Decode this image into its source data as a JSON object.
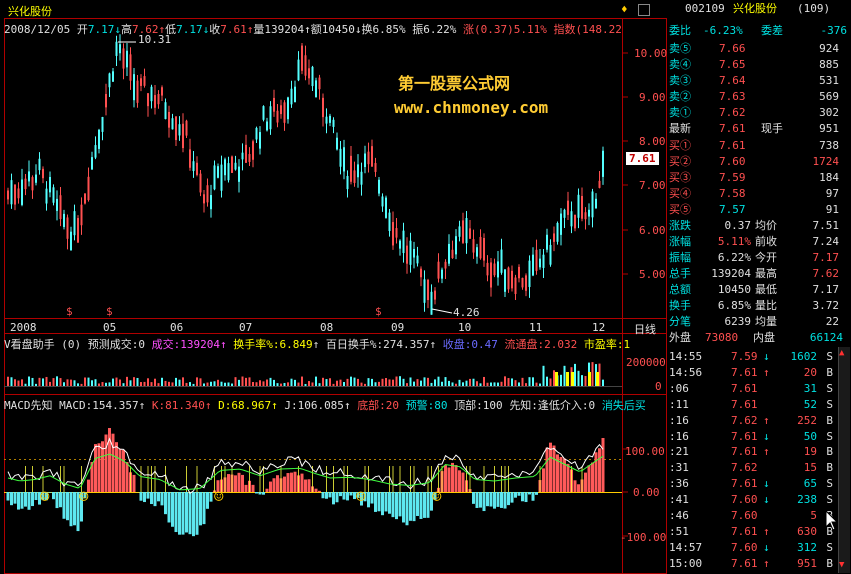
{
  "header": {
    "stock_name": "兴化股份",
    "quote_date": "2008/12/05",
    "open_label": "开",
    "open": "7.17",
    "high_label": "高",
    "high": "7.62",
    "low_label": "低",
    "low": "7.17",
    "close_label": "收",
    "close": "7.61",
    "volume_label": "量",
    "volume": "139204",
    "amount_label": "额",
    "amount": "10450",
    "turnover_label": "换",
    "turnover": "6.85%",
    "amplitude_label": "振",
    "amplitude": "6.22%",
    "change_label": "涨",
    "change": "(0.37)",
    "change_pct": "5.11%",
    "index_label": "指数",
    "index_value": "(148.22"
  },
  "watermark": {
    "line1": "第一股票公式网",
    "line2": "www.chnmoney.com"
  },
  "price_chart": {
    "y_ticks": [
      "10.00",
      "9.00",
      "8.00",
      "7.00",
      "6.00",
      "5.00"
    ],
    "current_price_tag": "7.61",
    "high_annotation": "10.31",
    "low_annotation": "4.26",
    "x_labels": [
      "2008",
      "05",
      "06",
      "07",
      "08",
      "09",
      "10",
      "11",
      "12"
    ],
    "period_label": "日线",
    "marker_glyph": "$"
  },
  "volume_panel": {
    "title": "V看盘助手 (0)",
    "predict_label": "预测成交:0",
    "volume_text": "成交:139204",
    "turnover_label": "换手率%:6.849",
    "hundred_day_label": "百日换手%:274.357",
    "close_label": "收盘:0.47",
    "float_label": "流通盘:2.032",
    "pe_label": "市盈率:1",
    "y_ticks": [
      "200000",
      "0"
    ]
  },
  "macd_panel": {
    "title": "MACD先知",
    "macd_value": "MACD:154.357",
    "k_value": "K:81.340",
    "d_value": "D:68.967",
    "j_value": "J:106.085",
    "bottom_label": "底部:20",
    "warn_label": "预警:80",
    "top_label": "顶部:100",
    "prophet_label": "先知:逢低介入:0",
    "vanish_label": "消失后买",
    "y_ticks": [
      "100.00",
      "0.00",
      "-100.00"
    ],
    "smiley_glyph": "☺"
  },
  "right_panel": {
    "code": "002109",
    "name": "兴化股份",
    "board": "(109)",
    "wei_bi_label": "委比",
    "wei_bi": "-6.23%",
    "wei_cha_label": "委差",
    "wei_cha": "-376",
    "sell": [
      {
        "label": "卖⑤",
        "price": "7.66",
        "vol": "924"
      },
      {
        "label": "卖④",
        "price": "7.65",
        "vol": "885"
      },
      {
        "label": "卖③",
        "price": "7.64",
        "vol": "531"
      },
      {
        "label": "卖②",
        "price": "7.63",
        "vol": "569"
      },
      {
        "label": "卖①",
        "price": "7.62",
        "vol": "302"
      }
    ],
    "latest_label": "最新",
    "latest": "7.61",
    "cur_vol_label": "现手",
    "cur_vol": "951",
    "buy": [
      {
        "label": "买①",
        "price": "7.61",
        "vol": "738"
      },
      {
        "label": "买②",
        "price": "7.60",
        "vol": "1724"
      },
      {
        "label": "买③",
        "price": "7.59",
        "vol": "184"
      },
      {
        "label": "买④",
        "price": "7.58",
        "vol": "97"
      },
      {
        "label": "买⑤",
        "price": "7.57",
        "vol": "91"
      }
    ],
    "stats": [
      {
        "l1": "涨跌",
        "v1": "0.37",
        "l2": "均价",
        "v2": "7.51"
      },
      {
        "l1": "涨幅",
        "v1": "5.11%",
        "l2": "前收",
        "v2": "7.24"
      },
      {
        "l1": "振幅",
        "v1": "6.22%",
        "l2": "今开",
        "v2": "7.17"
      },
      {
        "l1": "总手",
        "v1": "139204",
        "l2": "最高",
        "v2": "7.62"
      },
      {
        "l1": "总额",
        "v1": "10450",
        "l2": "最低",
        "v2": "7.17"
      },
      {
        "l1": "换手",
        "v1": "6.85%",
        "l2": "量比",
        "v2": "3.72"
      },
      {
        "l1": "分笔",
        "v1": "6239",
        "l2": "均量",
        "v2": "22"
      }
    ],
    "outer_label": "外盘",
    "outer": "73080",
    "inner_label": "内盘",
    "inner": "66124",
    "ticks": [
      {
        "t": "14:55",
        "p": "7.59",
        "dir": "↓",
        "v": "1602",
        "s": "S"
      },
      {
        "t": "14:56",
        "p": "7.61",
        "dir": "↑",
        "v": "20",
        "s": "B"
      },
      {
        "t": ":06",
        "p": "7.61",
        "dir": "",
        "v": "31",
        "s": "S"
      },
      {
        "t": ":11",
        "p": "7.61",
        "dir": "",
        "v": "52",
        "s": "S"
      },
      {
        "t": ":16",
        "p": "7.62",
        "dir": "↑",
        "v": "252",
        "s": "B"
      },
      {
        "t": ":16",
        "p": "7.61",
        "dir": "↓",
        "v": "50",
        "s": "S"
      },
      {
        "t": ":21",
        "p": "7.61",
        "dir": "↑",
        "v": "19",
        "s": "B"
      },
      {
        "t": ":31",
        "p": "7.62",
        "dir": "",
        "v": "15",
        "s": "B"
      },
      {
        "t": ":36",
        "p": "7.61",
        "dir": "↓",
        "v": "65",
        "s": "S"
      },
      {
        "t": ":41",
        "p": "7.60",
        "dir": "↓",
        "v": "238",
        "s": "S"
      },
      {
        "t": ":46",
        "p": "7.60",
        "dir": "",
        "v": "5",
        "s": "B"
      },
      {
        "t": ":51",
        "p": "7.61",
        "dir": "↑",
        "v": "630",
        "s": "B"
      },
      {
        "t": "14:57",
        "p": "7.60",
        "dir": "↓",
        "v": "312",
        "s": "S"
      },
      {
        "t": "15:00",
        "p": "7.61",
        "dir": "↑",
        "v": "951",
        "s": "B"
      }
    ]
  }
}
